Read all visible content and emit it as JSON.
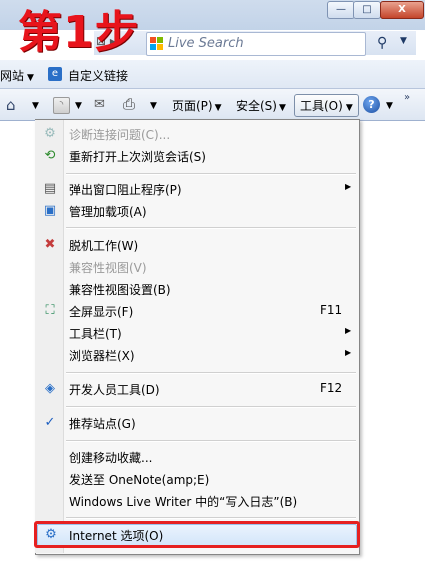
{
  "step_label": "第1步",
  "window": {
    "min": "—",
    "max": "□",
    "close": "X"
  },
  "search": {
    "placeholder": "Live Search"
  },
  "favorites_bar": {
    "sites": "网站",
    "custom_links": "自定义链接"
  },
  "command_bar": {
    "page": "页面(P)",
    "safety": "安全(S)",
    "tools": "工具(O)"
  },
  "menu": {
    "items": [
      {
        "label": "诊断连接问题(C)...",
        "disabled": true
      },
      {
        "label": "重新打开上次浏览会话(S)"
      },
      {
        "label": "弹出窗口阻止程序(P)",
        "submenu": true
      },
      {
        "label": "管理加载项(A)"
      },
      {
        "label": "脱机工作(W)"
      },
      {
        "label": "兼容性视图(V)",
        "disabled": true
      },
      {
        "label": "兼容性视图设置(B)"
      },
      {
        "label": "全屏显示(F)",
        "shortcut": "F11"
      },
      {
        "label": "工具栏(T)",
        "submenu": true
      },
      {
        "label": "浏览器栏(X)",
        "submenu": true
      },
      {
        "label": "开发人员工具(D)",
        "shortcut": "F12"
      },
      {
        "label": "推荐站点(G)",
        "checked": true
      },
      {
        "label": "创建移动收藏..."
      },
      {
        "label": "发送至 OneNote(amp;E)"
      },
      {
        "label": "Windows Live Writer 中的“写入日志”(B)"
      },
      {
        "label": "Internet 选项(O)",
        "highlighted": true
      }
    ]
  },
  "colors": {
    "highlight_box": "#e62020",
    "step_label": "#e8141c"
  }
}
